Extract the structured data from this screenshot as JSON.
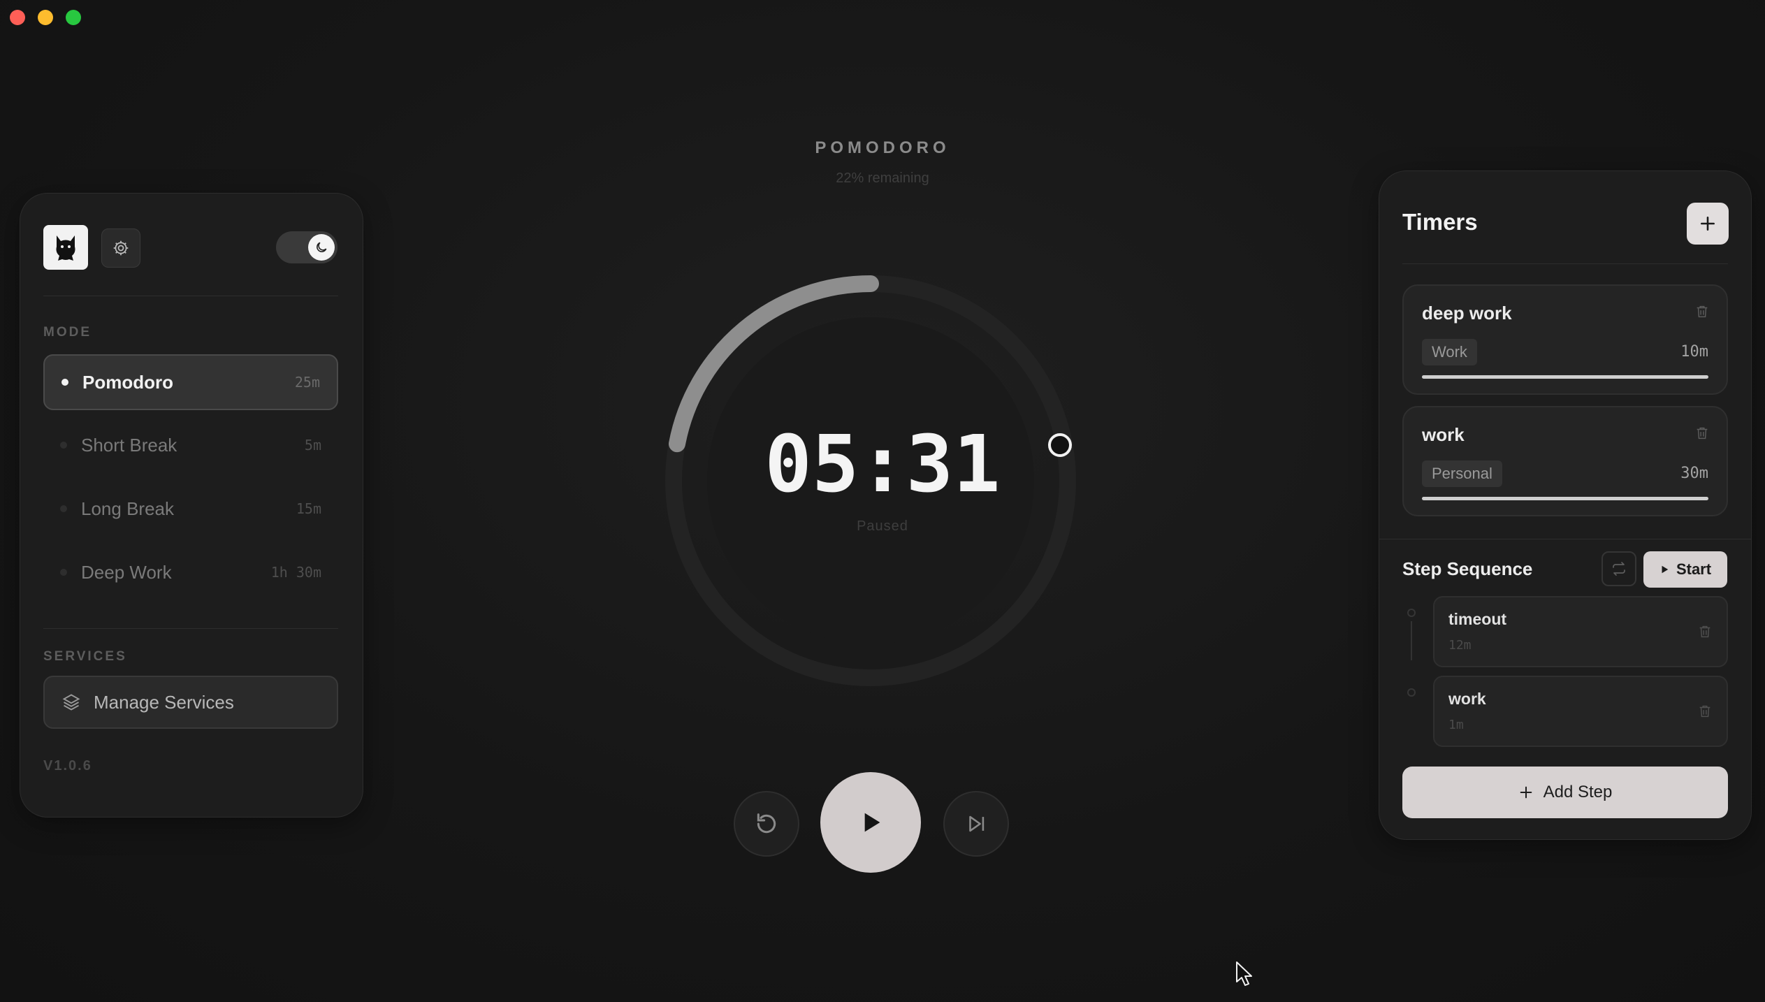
{
  "window": {
    "controls": [
      "close",
      "minimize",
      "maximize"
    ]
  },
  "colors": {
    "background": "#161616",
    "panel": "#1d1d1d",
    "accent_light": "#d7d2d2",
    "text_primary": "#f2f2f2"
  },
  "sidebar": {
    "logo_icon": "cat-icon",
    "settings_icon": "gear-icon",
    "theme_toggle_icon": "moon-icon",
    "mode_label": "MODE",
    "modes": [
      {
        "label": "Pomodoro",
        "duration": "25m",
        "active": true
      },
      {
        "label": "Short Break",
        "duration": "5m",
        "active": false
      },
      {
        "label": "Long Break",
        "duration": "15m",
        "active": false
      },
      {
        "label": "Deep Work",
        "duration": "1h 30m",
        "active": false
      }
    ],
    "services_label": "SERVICES",
    "manage_services_label": "Manage Services",
    "manage_services_icon": "layers-icon",
    "version": "V1.0.6"
  },
  "timer": {
    "mode_title": "POMODORO",
    "remaining_text": "22% remaining",
    "remaining_fraction": 0.22,
    "time": "05:31",
    "status": "Paused",
    "controls": {
      "reset_icon": "reset-icon",
      "play_icon": "play-icon",
      "skip_icon": "skip-forward-icon"
    }
  },
  "timers_panel": {
    "title": "Timers",
    "add_icon": "plus-icon",
    "timers": [
      {
        "name": "deep work",
        "tag": "Work",
        "duration": "10m",
        "progress": 1.0
      },
      {
        "name": "work",
        "tag": "Personal",
        "duration": "30m",
        "progress": 1.0
      }
    ],
    "sequence": {
      "title": "Step Sequence",
      "repeat_icon": "repeat-icon",
      "start_label": "Start",
      "steps": [
        {
          "name": "timeout",
          "duration": "12m"
        },
        {
          "name": "work",
          "duration": "1m"
        }
      ],
      "add_step_label": "Add Step"
    }
  }
}
